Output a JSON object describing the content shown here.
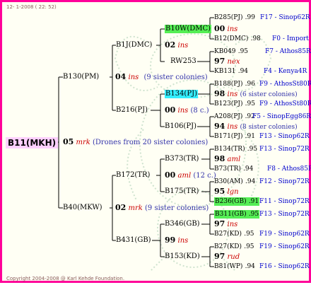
{
  "header": "12- 1-2008 ( 22: 52)",
  "footer": "Copyright 2004-2008 @ Karl Kehde Foundation.",
  "colors": {
    "border": "#ff0099",
    "root_bg": "#ffd0ff",
    "highlight_green": "#55ee55",
    "highlight_cyan": "#33eeff",
    "source_blue": "#0000cc",
    "note_blue": "#3333aa",
    "mark_red": "#cc0000"
  },
  "root": {
    "name": "B11(MKH)",
    "year": "05",
    "mark": "mrk",
    "note": "(Drones from 20 sister colonies)"
  },
  "gen1": [
    {
      "name": "B130(PM)",
      "year": "04",
      "mark": "ins",
      "note": "(9 sister colonies)"
    },
    {
      "name": "B40(MKW)",
      "year": "02",
      "mark": "mrk",
      "note": "(9 sister colonies)"
    }
  ],
  "gen2": [
    {
      "name": "B1J(DMC)",
      "year": "02",
      "mark": "ins"
    },
    {
      "name": "B216(PJ)",
      "year": "00",
      "mark": "ins",
      "note": "(8 c.)"
    },
    {
      "name": "B172(TR)",
      "year": "00",
      "mark": "aml",
      "note": "(12 c.)"
    },
    {
      "name": "B431(GB)",
      "year": "99",
      "mark": "ins"
    }
  ],
  "gen3": [
    {
      "name": "B10W(DMC)",
      "year": "00",
      "mark": "ins"
    },
    {
      "name": "RW253",
      "year": "97",
      "mark": "nex"
    },
    {
      "name": "B134(PJ)",
      "year": "98",
      "mark": "ins",
      "note": "(6 sister colonies)"
    },
    {
      "name": "B106(PJ)",
      "year": "94",
      "mark": "ins",
      "note": "(8 sister colonies)"
    },
    {
      "name": "B373(TR)",
      "year": "98",
      "mark": "aml"
    },
    {
      "name": "B175(TR)",
      "year": "95",
      "mark": "lgn"
    },
    {
      "name": "B346(GB)",
      "year": "97",
      "mark": "ins"
    },
    {
      "name": "B153(KD)",
      "year": "97",
      "mark": "rud"
    }
  ],
  "gen4": [
    {
      "name": "B285(PJ)",
      "yr": ".99",
      "src": "F17 - Sinop62R"
    },
    {
      "name": "B12(DMC)",
      "yr": ".98",
      "src": "F0 - Import"
    },
    {
      "name": "KB049",
      "yr": ".95",
      "src": "F7 - Athos85R"
    },
    {
      "name": "KB131",
      "yr": ".94",
      "src": "F4 - Kenya4R"
    },
    {
      "name": "B188(PJ)",
      "yr": ".96",
      "src": "F9 - AthosSt80R"
    },
    {
      "name": "B123(PJ)",
      "yr": ".95",
      "src": "F9 - AthosSt80R"
    },
    {
      "name": "A208(PJ)",
      "yr": ".92",
      "src": "F5 - SinopEgg86R"
    },
    {
      "name": "B171(PJ)",
      "yr": ".91",
      "src": "F13 - Sinop62R"
    },
    {
      "name": "B134(TR)",
      "yr": ".95",
      "src": "F13 - Sinop72R"
    },
    {
      "name": "B73(TR)",
      "yr": ".94",
      "src": "F8 - Athos85R"
    },
    {
      "name": "B30(AM)",
      "yr": ".94",
      "src": "F12 - Sinop72R"
    },
    {
      "name": "B236(GB)",
      "yr": ".91",
      "src": "F11 - Sinop72R"
    },
    {
      "name": "B311(GB)",
      "yr": ".95",
      "src": "F13 - Sinop72R"
    },
    {
      "name": "B27(KD)",
      "yr": ".95",
      "src": "F19 - Sinop62R"
    },
    {
      "name": "B27(KD)",
      "yr": ".95",
      "src": "F19 - Sinop62R"
    },
    {
      "name": "B81(WP)",
      "yr": ".94",
      "src": "F16 - Sinop62R"
    }
  ]
}
